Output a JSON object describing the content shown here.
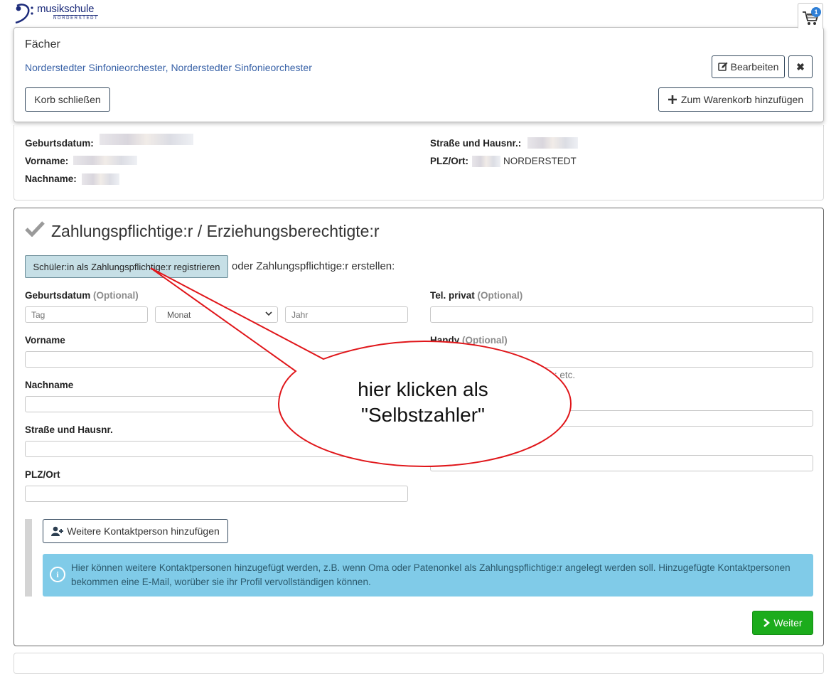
{
  "header": {
    "logo_text": "musikschule",
    "logo_sub": "NORDERSTEDT",
    "cart_count": "1"
  },
  "cart": {
    "heading": "Fächer",
    "items": "Norderstedter Sinfonieorchester, Norderstedter Sinfonieorchester",
    "edit_label": "Bearbeiten",
    "close_x_label": "✖",
    "close_cart_label": "Korb schließen",
    "add_to_cart_label": "Zum Warenkorb hinzufügen"
  },
  "student": {
    "geburtsdatum_label": "Geburtsdatum:",
    "vorname_label": "Vorname:",
    "nachname_label": "Nachname:",
    "strasse_label": "Straße und Hausnr.:",
    "plz_label": "PLZ/Ort:",
    "ort_value": "NORDERSTEDT"
  },
  "payer": {
    "title": "Zahlungspflichtige:r / Erziehungsberechtigte:r",
    "register_button": "Schüler:in als Zahlungspflichtige:r registrieren",
    "oder_text": "oder Zahlungspflichtige:r erstellen:",
    "optional": "(Optional)",
    "fields": {
      "geburtsdatum": "Geburtsdatum",
      "tag_placeholder": "Tag",
      "monat_selected": "Monat",
      "jahr_placeholder": "Jahr",
      "tel_privat": "Tel. privat",
      "vorname": "Vorname",
      "handy": "Handy",
      "nachname": "Nachname",
      "strasse": "Straße und Hausnr.",
      "plz_ort": "PLZ/Ort"
    },
    "phone_hint": "und Sonderzeichen / - : etc.",
    "add_contact_button": "Weitere Kontaktperson hinzufügen",
    "info_text": "Hier können weitere Kontaktpersonen hinzugefügt werden, z.B. wenn Oma oder Patenonkel als Zahlungspflichtige:r angelegt werden soll. Hinzugefügte Kontaktpersonen bekommen eine E-Mail, worüber sie ihr Profil vervollständigen können.",
    "weiter_button": "Weiter"
  },
  "callout": {
    "line1": "hier klicken als",
    "line2": "\"Selbstzahler\"",
    "stroke_color": "#e0161a"
  }
}
